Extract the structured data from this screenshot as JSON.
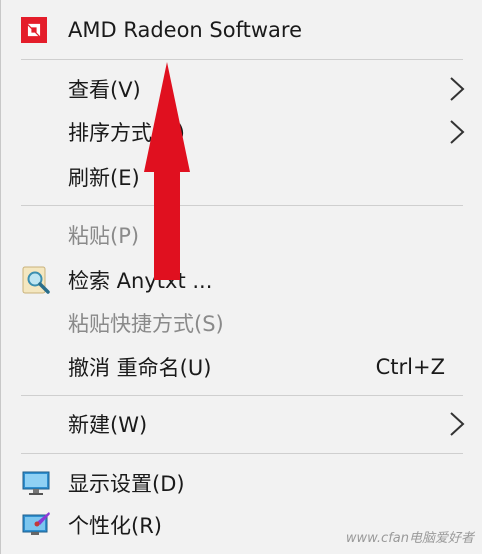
{
  "menu": {
    "items": [
      {
        "label": "AMD Radeon Software",
        "icon": "amd-icon"
      },
      {
        "label": "查看(V)",
        "submenu": true
      },
      {
        "label": "排序方式(O)",
        "submenu": true
      },
      {
        "label": "刷新(E)"
      },
      {
        "label": "粘贴(P)",
        "disabled": true
      },
      {
        "label": "检索 Anytxt ...",
        "icon": "magnifier-icon"
      },
      {
        "label": "粘贴快捷方式(S)",
        "disabled": true
      },
      {
        "label": "撤消 重命名(U)",
        "shortcut": "Ctrl+Z"
      },
      {
        "label": "新建(W)",
        "submenu": true
      },
      {
        "label": "显示设置(D)",
        "icon": "monitor-icon"
      },
      {
        "label": "个性化(R)",
        "icon": "personalize-icon"
      }
    ]
  },
  "colors": {
    "amd_red": "#e41d2a",
    "arrow_red": "#e0101f",
    "background": "#f2f2f2",
    "disabled_text": "#8a8a8a"
  },
  "watermark": "www.cfan电脑爱好者"
}
